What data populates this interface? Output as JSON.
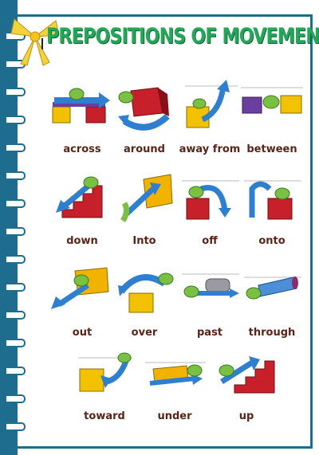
{
  "title": "PREPOSITIONS OF MOVEMENT",
  "colors": {
    "title": "#23a85a",
    "binding": "#1e6d8e",
    "label": "#5a2418",
    "arrow": "#2f7fd1",
    "cube_red": "#c8202a",
    "cube_yellow": "#f2c200",
    "worm": "#7ac143",
    "purple": "#6b3fa0"
  },
  "prepositions": [
    {
      "label": "across"
    },
    {
      "label": "around"
    },
    {
      "label": "away from"
    },
    {
      "label": "between"
    },
    {
      "label": "down"
    },
    {
      "label": "Into"
    },
    {
      "label": "off"
    },
    {
      "label": "onto"
    },
    {
      "label": "out"
    },
    {
      "label": "over"
    },
    {
      "label": "past"
    },
    {
      "label": "through"
    },
    {
      "label": "toward"
    },
    {
      "label": "under"
    },
    {
      "label": "up"
    }
  ]
}
